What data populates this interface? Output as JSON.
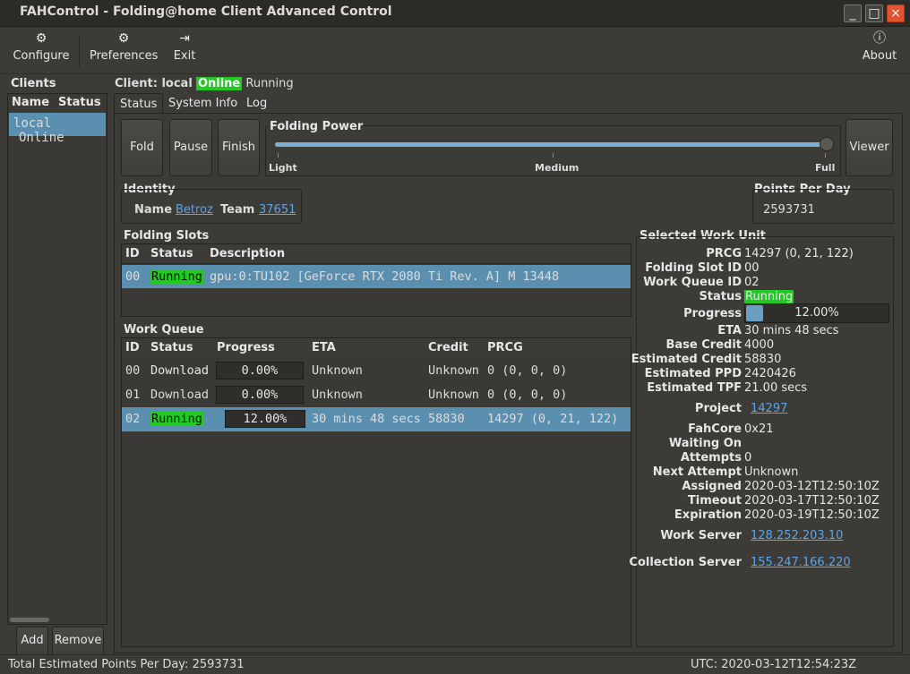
{
  "window": {
    "title": "FAHControl - Folding@home Client Advanced Control",
    "controls": {
      "minimize": "_",
      "maximize": "□",
      "close": "×"
    }
  },
  "toolbar": {
    "configure": "Configure",
    "preferences": "Preferences",
    "exit": "Exit",
    "about": "About",
    "icons": {
      "configure": "gear-icon",
      "preferences": "gear-icon",
      "exit": "exit-door-icon",
      "about": "info-icon"
    }
  },
  "clients": {
    "title": "Clients",
    "col_name": "Name",
    "col_status": "Status",
    "rows": [
      {
        "name": "local",
        "status": "Online"
      }
    ],
    "add": "Add",
    "remove": "Remove"
  },
  "client_header": {
    "prefix": "Client: local",
    "online": "Online",
    "state": "Running"
  },
  "tabs": [
    "Status",
    "System Info",
    "Log"
  ],
  "controls": {
    "fold": "Fold",
    "pause": "Pause",
    "finish": "Finish",
    "viewer": "Viewer"
  },
  "folding_power": {
    "title": "Folding Power",
    "light": "Light",
    "medium": "Medium",
    "full": "Full",
    "level": 1.0
  },
  "identity": {
    "title": "Identity",
    "name_label": "Name",
    "name": "Betroz",
    "team_label": "Team",
    "team": "37651"
  },
  "ppd": {
    "title": "Points Per Day",
    "value": "2593731"
  },
  "folding_slots": {
    "title": "Folding Slots",
    "headers": [
      "ID",
      "Status",
      "Description"
    ],
    "rows": [
      {
        "id": "00",
        "status": "Running",
        "description": "gpu:0:TU102 [GeForce RTX 2080 Ti Rev. A] M 13448"
      }
    ]
  },
  "work_queue": {
    "title": "Work Queue",
    "headers": [
      "ID",
      "Status",
      "Progress",
      "ETA",
      "Credit",
      "PRCG"
    ],
    "rows": [
      {
        "id": "00",
        "status": "Download",
        "progress": "0.00%",
        "eta": "Unknown",
        "credit": "Unknown",
        "prcg": "0 (0, 0, 0)"
      },
      {
        "id": "01",
        "status": "Download",
        "progress": "0.00%",
        "eta": "Unknown",
        "credit": "Unknown",
        "prcg": "0 (0, 0, 0)"
      },
      {
        "id": "02",
        "status": "Running",
        "progress": "12.00%",
        "eta": "30 mins 48 secs",
        "credit": "58830",
        "prcg": "14297 (0, 21, 122)"
      }
    ]
  },
  "selected_wu": {
    "title": "Selected Work Unit",
    "prcg_label": "PRCG",
    "prcg": "14297 (0, 21, 122)",
    "slot_label": "Folding Slot ID",
    "slot": "00",
    "queue_label": "Work Queue ID",
    "queue": "02",
    "status_label": "Status",
    "status": "Running",
    "progress_label": "Progress",
    "progress": "12.00%",
    "progress_fraction": 0.12,
    "eta_label": "ETA",
    "eta": "30 mins 48 secs",
    "base_credit_label": "Base Credit",
    "base_credit": "4000",
    "est_credit_label": "Estimated Credit",
    "est_credit": "58830",
    "est_ppd_label": "Estimated PPD",
    "est_ppd": "2420426",
    "est_tpf_label": "Estimated TPF",
    "est_tpf": "21.00 secs",
    "project_label": "Project",
    "project": "14297",
    "fahcore_label": "FahCore",
    "fahcore": "0x21",
    "waiting_label": "Waiting On",
    "waiting": "",
    "attempts_label": "Attempts",
    "attempts": "0",
    "next_attempt_label": "Next Attempt",
    "next_attempt": "Unknown",
    "assigned_label": "Assigned",
    "assigned": "2020-03-12T12:50:10Z",
    "timeout_label": "Timeout",
    "timeout": "2020-03-17T12:50:10Z",
    "expiration_label": "Expiration",
    "expiration": "2020-03-19T12:50:10Z",
    "work_server_label": "Work Server",
    "work_server": "128.252.203.10",
    "collection_server_label": "Collection Server",
    "collection_server": "155.247.166.220"
  },
  "statusbar": {
    "total_ppd": "Total Estimated Points Per Day: 2593731",
    "utc": "UTC: 2020-03-12T12:54:23Z"
  },
  "colors": {
    "running": "#24c824",
    "selected_row": "#5b8fb0",
    "link": "#5ea4e6",
    "close": "#e2532f"
  }
}
